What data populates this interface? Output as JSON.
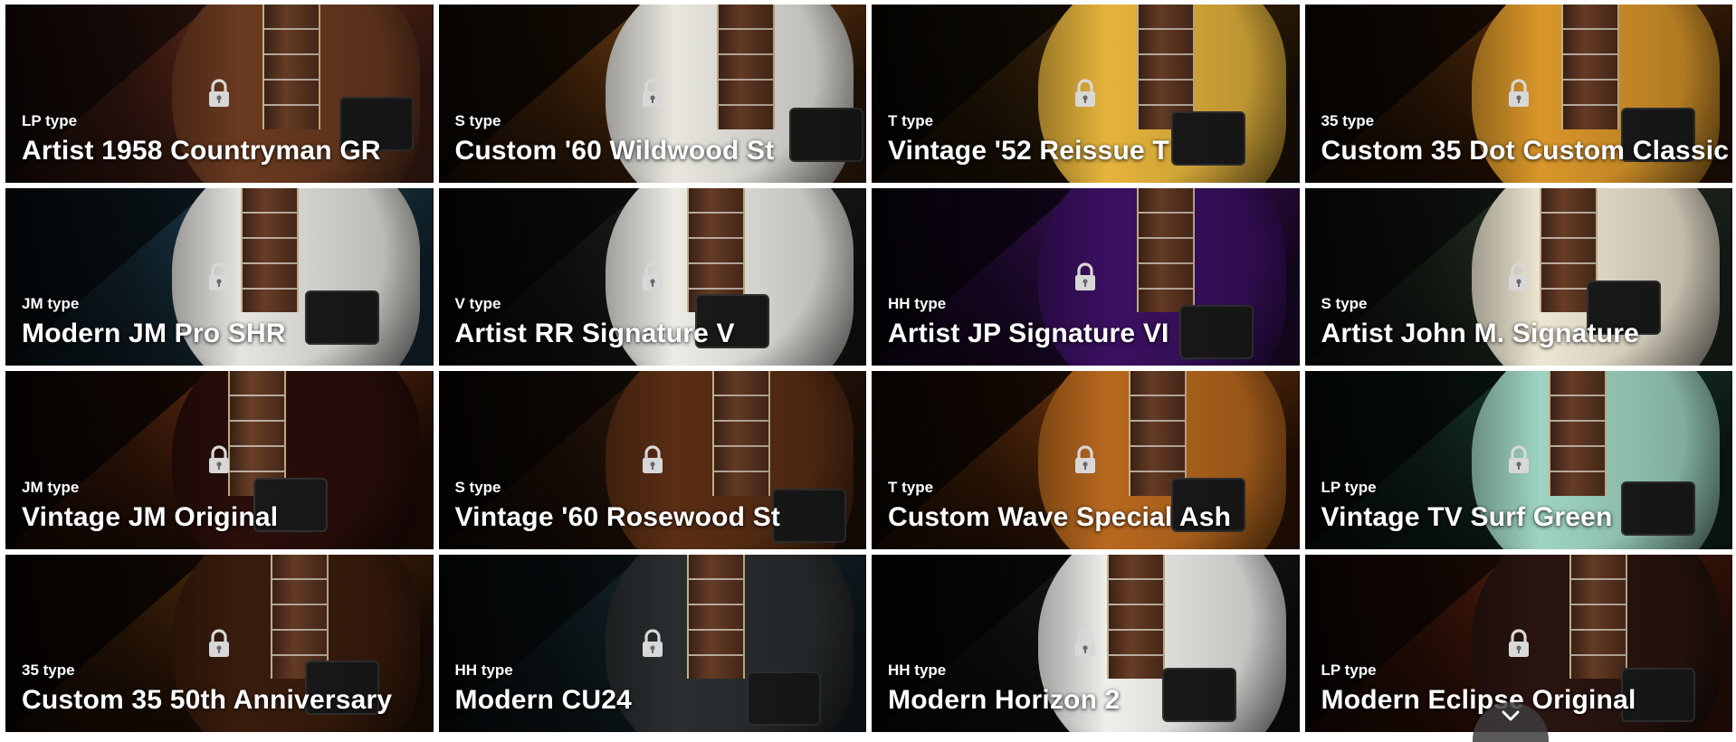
{
  "presets": [
    {
      "type": "LP type",
      "name": "Artist 1958 Countryman GR",
      "bg": "#3a1a12",
      "accent": "#8a3a24",
      "body": "#6a3a20"
    },
    {
      "type": "S type",
      "name": "Custom '60 Wildwood St",
      "bg": "#2a1608",
      "accent": "#b8641c",
      "body": "#e8e6df"
    },
    {
      "type": "T type",
      "name": "Vintage '52 Reissue T",
      "bg": "#1c1206",
      "accent": "#6a4010",
      "body": "#e5b43c"
    },
    {
      "type": "35 type",
      "name": "Custom 35 Dot Custom Classic",
      "bg": "#221004",
      "accent": "#8a4a12",
      "body": "#d9962a"
    },
    {
      "type": "JM type",
      "name": "Modern JM Pro SHR",
      "bg": "#10222c",
      "accent": "#2c5a72",
      "body": "#e6e4df"
    },
    {
      "type": "V type",
      "name": "Artist RR Signature V",
      "bg": "#121212",
      "accent": "#2e2e2e",
      "body": "#ecebe6"
    },
    {
      "type": "HH type",
      "name": "Artist JP Signature VI",
      "bg": "#1a0828",
      "accent": "#5a1a86",
      "body": "#3a1060"
    },
    {
      "type": "S type",
      "name": "Artist John M. Signature",
      "bg": "#182018",
      "accent": "#3a4a3a",
      "body": "#ede6d2"
    },
    {
      "type": "JM type",
      "name": "Vintage JM Original",
      "bg": "#200c04",
      "accent": "#a0481a",
      "body": "#2a0e0a"
    },
    {
      "type": "S type",
      "name": "Vintage '60 Rosewood St",
      "bg": "#1a0e06",
      "accent": "#4a2812",
      "body": "#5a2e14"
    },
    {
      "type": "T type",
      "name": "Custom Wave Special Ash",
      "bg": "#2a1204",
      "accent": "#c0601a",
      "body": "#b8681e"
    },
    {
      "type": "LP type",
      "name": "Vintage TV Surf Green",
      "bg": "#0c1c18",
      "accent": "#2a5a50",
      "body": "#9ed4c2"
    },
    {
      "type": "35 type",
      "name": "Custom 35 50th Anniversary",
      "bg": "#1a0c04",
      "accent": "#8a4a14",
      "body": "#3a1c0c"
    },
    {
      "type": "HH type",
      "name": "Modern CU24",
      "bg": "#0e181c",
      "accent": "#1e3a44",
      "body": "#2a2e30"
    },
    {
      "type": "HH type",
      "name": "Modern Horizon 2",
      "bg": "#0c0c0c",
      "accent": "#2a2a2a",
      "body": "#f0efec"
    },
    {
      "type": "LP type",
      "name": "Modern Eclipse Original",
      "bg": "#2a0e06",
      "accent": "#7a2a14",
      "body": "#2a1410"
    }
  ],
  "icons": {
    "lock": "lock-icon",
    "scroll": "chevron-down-icon"
  }
}
